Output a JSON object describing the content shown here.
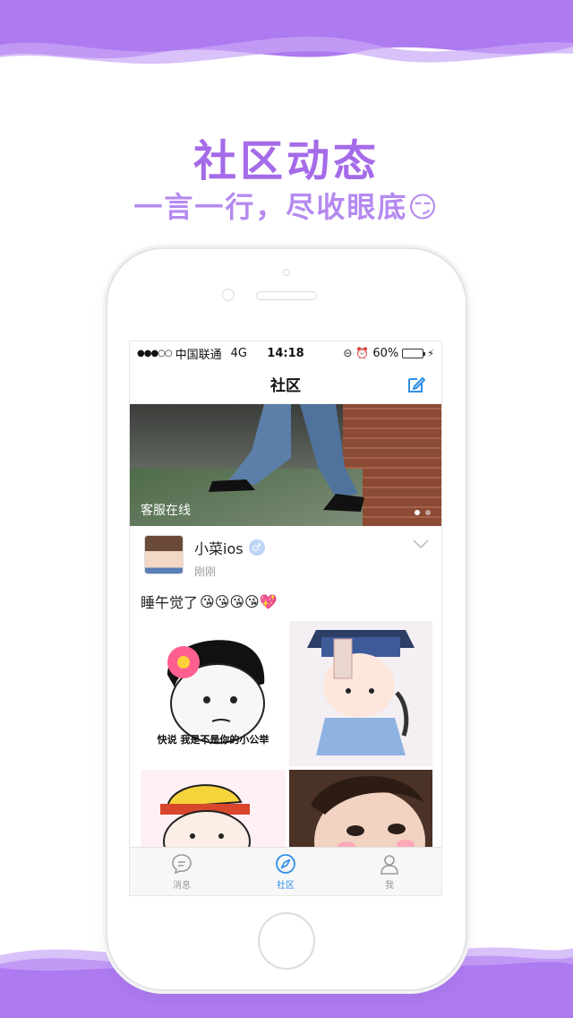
{
  "promo": {
    "headline": "社区动态",
    "subline": "一言一行，尽收眼底😏"
  },
  "status_bar": {
    "signal": "●●●○○",
    "carrier": "中国联通",
    "network": "4G",
    "time": "14:18",
    "battery": "60%",
    "battery_level": 0.6
  },
  "nav": {
    "title": "社区",
    "edit_icon": "edit-icon"
  },
  "banner": {
    "label": "客服在线",
    "pages": 2,
    "active_page": 1
  },
  "post": {
    "user_name": "小菜ios",
    "gender_symbol": "♂",
    "time": "刚刚",
    "text": "睡午觉了",
    "emojis": "😘😘😘😘💖",
    "images": [
      {
        "caption": "快说 我是不是你的小公举"
      },
      {
        "caption": ""
      },
      {
        "caption": ""
      },
      {
        "caption": ""
      }
    ]
  },
  "tabbar": {
    "items": [
      {
        "label": "消息",
        "icon": "message-icon",
        "active": false
      },
      {
        "label": "社区",
        "icon": "compass-icon",
        "active": true
      },
      {
        "label": "我",
        "icon": "person-icon",
        "active": false
      }
    ]
  },
  "colors": {
    "brand_purple": "#a56be8",
    "active_blue": "#2f8ee6"
  }
}
